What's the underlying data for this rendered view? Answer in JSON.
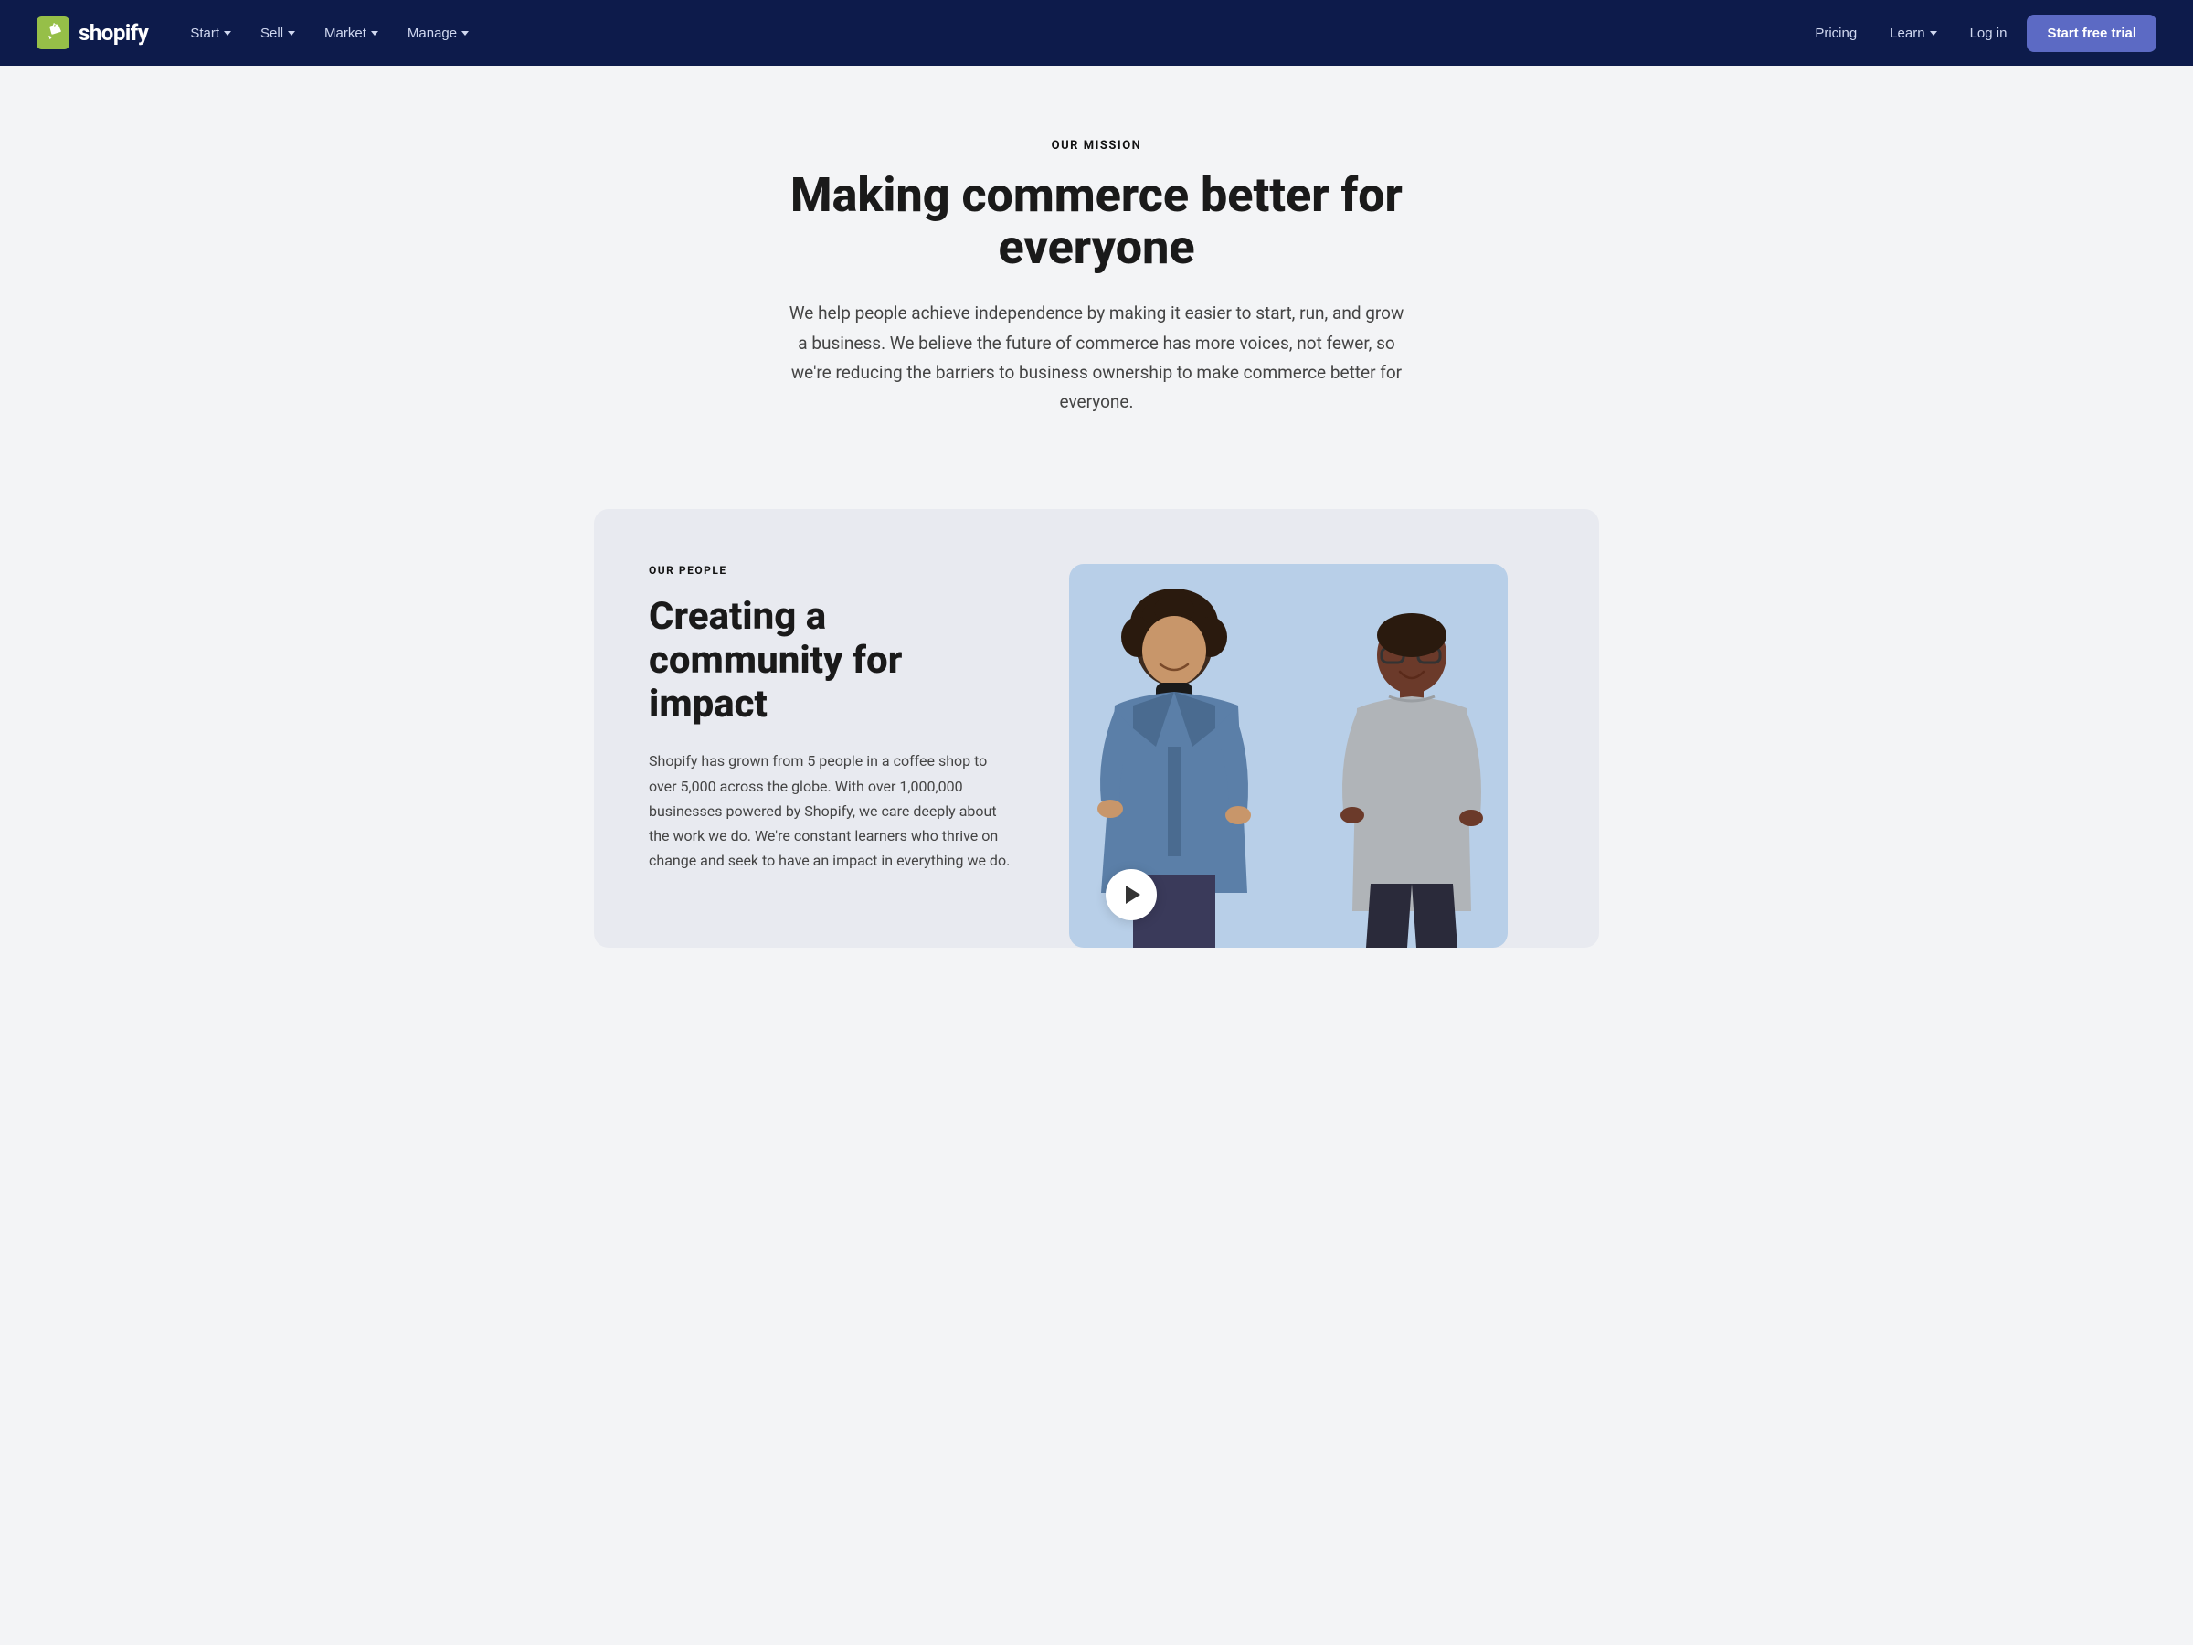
{
  "nav": {
    "logo_text": "shopify",
    "items_left": [
      {
        "label": "Start",
        "has_dropdown": true
      },
      {
        "label": "Sell",
        "has_dropdown": true
      },
      {
        "label": "Market",
        "has_dropdown": true
      },
      {
        "label": "Manage",
        "has_dropdown": true
      }
    ],
    "items_right": [
      {
        "label": "Pricing",
        "has_dropdown": false
      },
      {
        "label": "Learn",
        "has_dropdown": true
      },
      {
        "label": "Log in",
        "has_dropdown": false
      }
    ],
    "cta": "Start free trial"
  },
  "hero": {
    "eyebrow": "OUR MISSION",
    "title": "Making commerce better for everyone",
    "description": "We help people achieve independence by making it easier to start, run, and grow a business. We believe the future of commerce has more voices, not fewer, so we're reducing the barriers to business ownership to make commerce better for everyone."
  },
  "people": {
    "eyebrow": "OUR PEOPLE",
    "title": "Creating a community for impact",
    "description": "Shopify has grown from 5 people in a coffee shop to over 5,000 across the globe. With over 1,000,000 businesses powered by Shopify, we care deeply about the work we do. We're constant learners who thrive on change and seek to have an impact in everything we do.",
    "play_button_label": "Play video"
  }
}
